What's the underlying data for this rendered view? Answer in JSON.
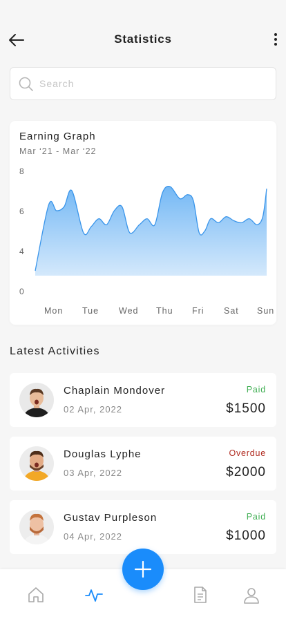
{
  "header": {
    "title": "Statistics"
  },
  "search": {
    "placeholder": "Search"
  },
  "chart_card": {
    "title": "Earning Graph",
    "subtitle": "Mar ‘21 - Mar ‘22"
  },
  "chart_data": {
    "type": "area",
    "title": "Earning Graph",
    "subtitle": "Mar ‘21 - Mar ‘22",
    "y_ticks": [
      "8",
      "6",
      "4",
      "0"
    ],
    "x_labels": [
      "Mon",
      "Tue",
      "Wed",
      "Thu",
      "Fri",
      "Sat",
      "Sun"
    ],
    "grid": false,
    "color": "#7fbff5",
    "series": [
      {
        "x": [
          0,
          0.35,
          0.55,
          0.75,
          0.95,
          1.25,
          1.45,
          1.65,
          1.85,
          2.05,
          2.25,
          2.45,
          2.7,
          2.9,
          3.1,
          3.3,
          3.5,
          3.75,
          3.95,
          4.1,
          4.25,
          4.4,
          4.55,
          4.75,
          4.95,
          5.15,
          5.35,
          5.55,
          5.75,
          5.9,
          6.0
        ],
        "y": [
          3.0,
          6.3,
          6.0,
          6.2,
          7.0,
          4.9,
          5.2,
          5.6,
          5.3,
          6.0,
          6.2,
          4.9,
          5.3,
          5.6,
          5.3,
          6.9,
          7.2,
          6.6,
          6.8,
          6.5,
          4.9,
          5.0,
          5.6,
          5.4,
          5.7,
          5.5,
          5.4,
          5.6,
          5.3,
          5.7,
          7.1
        ]
      }
    ]
  },
  "activities": {
    "title": "Latest Activities",
    "items": [
      {
        "name": "Chaplain Mondover",
        "date": "02 Apr, 2022",
        "status": "Paid",
        "status_color": "#3fae52",
        "amount": "$1500"
      },
      {
        "name": "Douglas Lyphe",
        "date": "03 Apr, 2022",
        "status": "Overdue",
        "status_color": "#b02a1f",
        "amount": "$2000"
      },
      {
        "name": "Gustav Purpleson",
        "date": "04 Apr, 2022",
        "status": "Paid",
        "status_color": "#3fae52",
        "amount": "$1000"
      }
    ]
  },
  "bottom_nav": {
    "active_color": "#1a8cfb",
    "icons": [
      "home-icon",
      "activity-icon",
      "add-icon",
      "document-icon",
      "user-icon"
    ]
  }
}
